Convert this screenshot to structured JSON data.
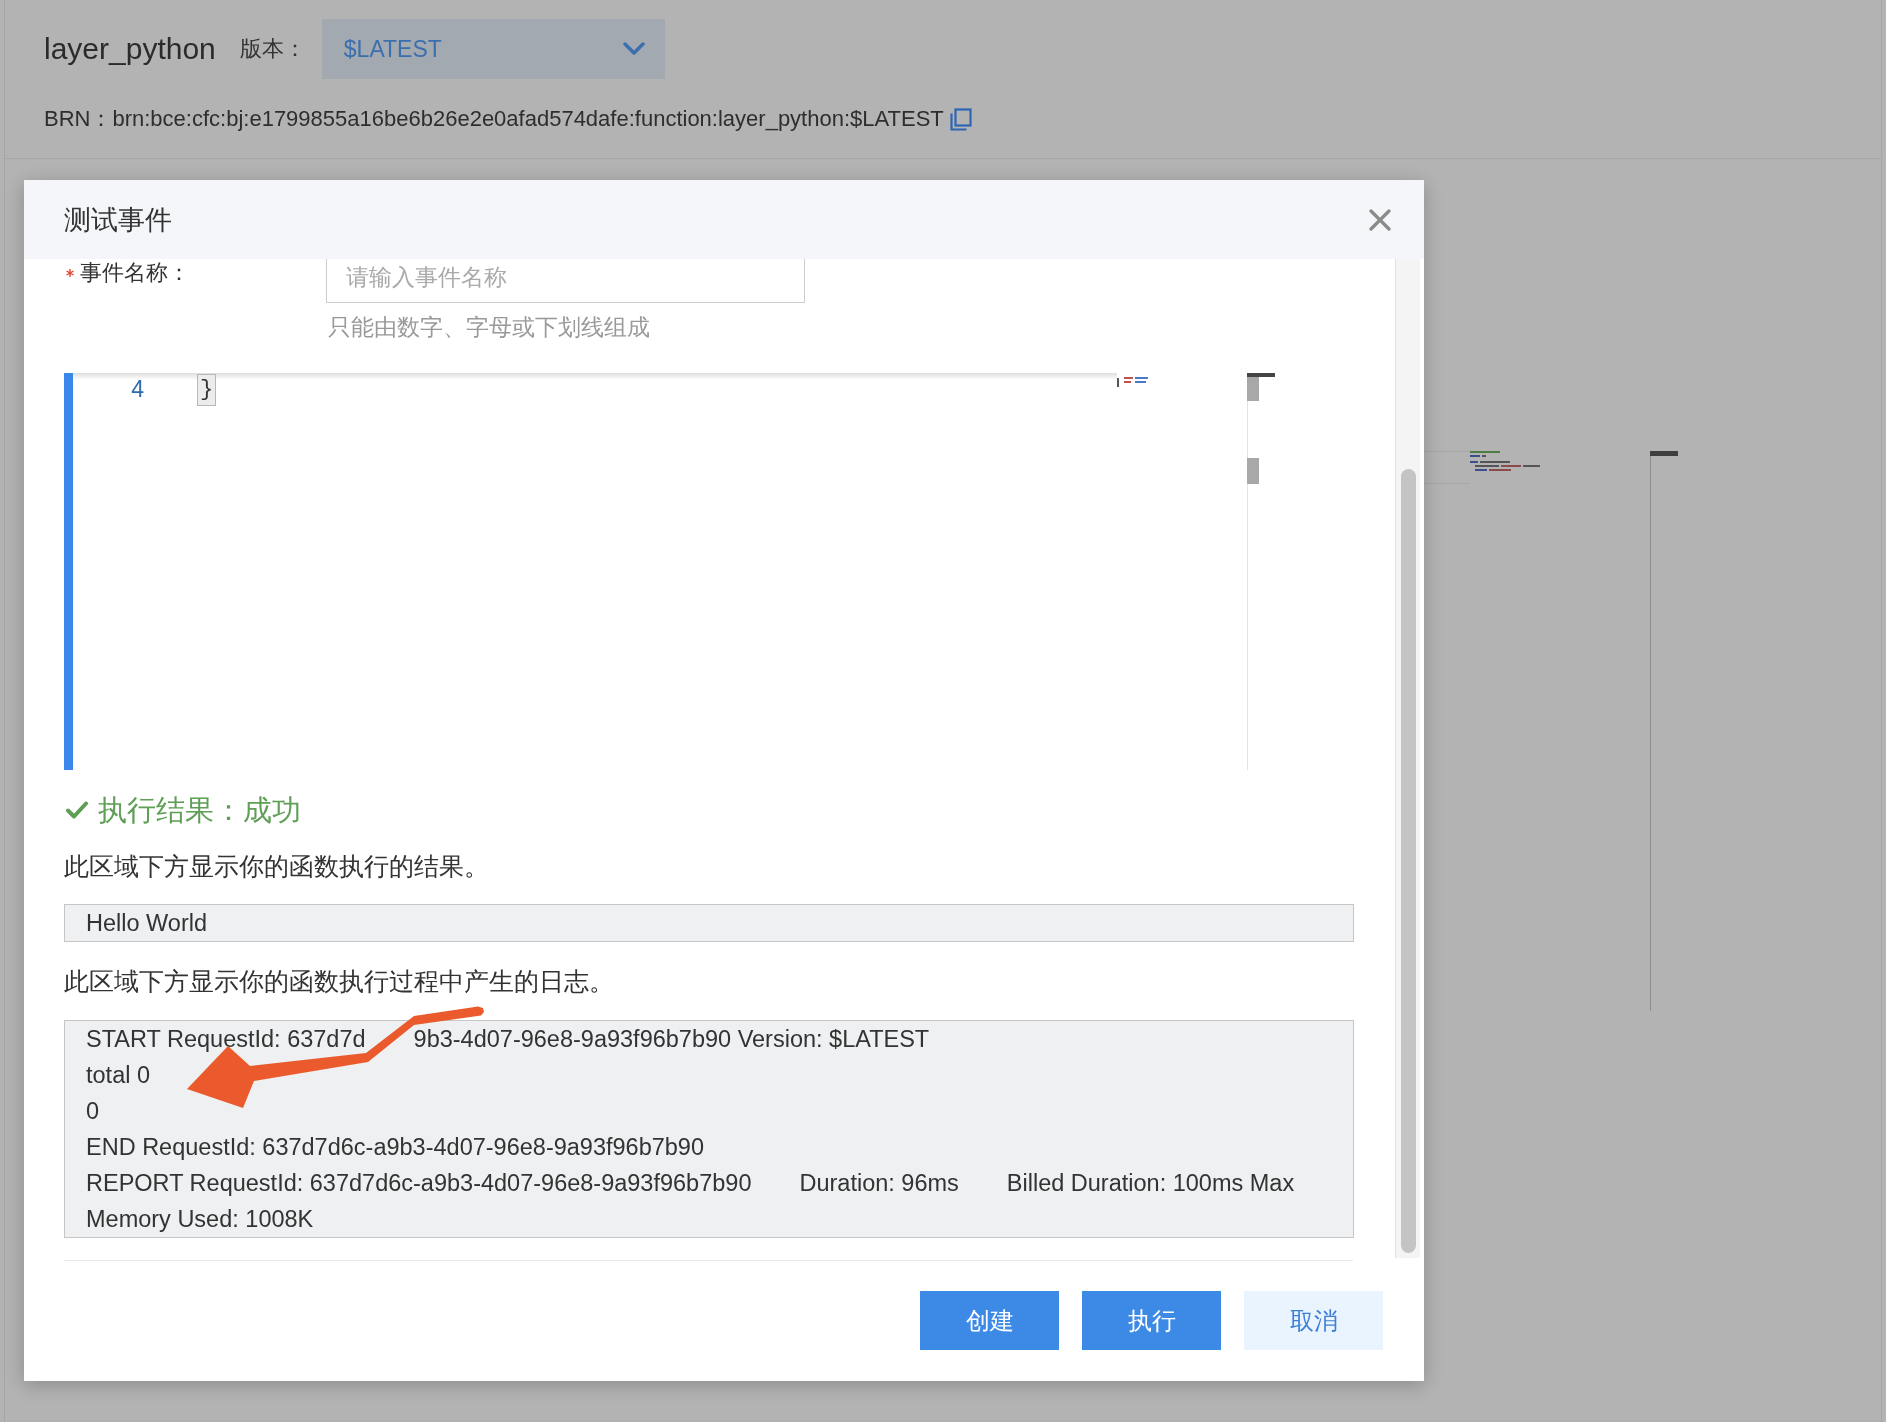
{
  "page": {
    "title": "layer_python",
    "version_label": "版本：",
    "version_select": {
      "value": "$LATEST"
    },
    "brn_label": "BRN：",
    "brn": "brn:bce:cfc:bj:e1799855a16be6b26e2e0afad574dafe:function:layer_python:$LATEST"
  },
  "dialog": {
    "title": "测试事件",
    "form": {
      "label": "事件名称：",
      "required": true,
      "placeholder": "请输入事件名称",
      "hint": "只能由数字、字母或下划线组成"
    },
    "editor": {
      "lines": [
        {
          "number": "4",
          "code": "}",
          "matched_bracket": true
        }
      ]
    },
    "result": {
      "succeeded": true,
      "title": "执行结果：成功",
      "output_label": "此区域下方显示你的函数执行的结果。",
      "output": "Hello World",
      "log_label": "此区域下方显示你的函数执行过程中产生的日志。",
      "log_lines": [
        {
          "parts": [
            "START RequestId: 637d7d",
            "9b3-4d07-96e8-9a93f96b7b90 Version: $LATEST"
          ]
        },
        {
          "parts": [
            "total 0"
          ]
        },
        {
          "parts": [
            "0"
          ]
        },
        {
          "parts": [
            "END RequestId: 637d7d6c-a9b3-4d07-96e8-9a93f96b7b90"
          ]
        },
        {
          "parts": [
            "REPORT RequestId: 637d7d6c-a9b3-4d07-96e8-9a93f96b7b90",
            "Duration: 96ms",
            "Billed Duration: 100ms Max"
          ]
        },
        {
          "parts": [
            "Memory Used: 1008K"
          ]
        }
      ]
    },
    "buttons": [
      {
        "label": "创建",
        "kind": "primary"
      },
      {
        "label": "执行",
        "kind": "primary"
      },
      {
        "label": "取消",
        "kind": "secondary"
      }
    ]
  },
  "annotations": [
    {
      "kind": "arrow"
    }
  ]
}
